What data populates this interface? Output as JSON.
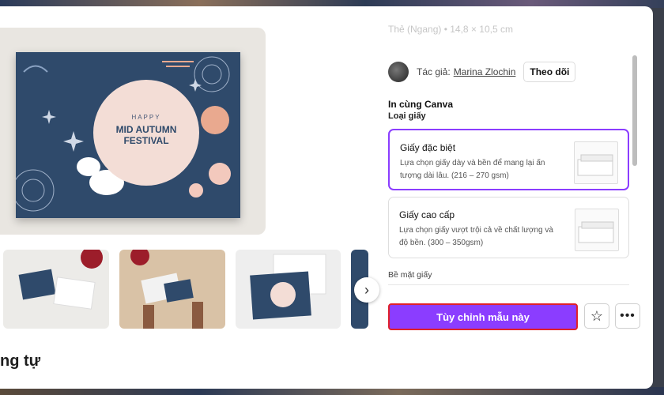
{
  "preview": {
    "card_line1": "HAPPY",
    "card_line2": "MID AUTUMN",
    "card_line3": "FESTIVAL"
  },
  "right": {
    "faded_text": "Thẻ (Ngang) • 14,8 × 10,5 cm",
    "author_label": "Tác giả:",
    "author_name": "Marina Zlochin",
    "follow_label": "Theo dõi",
    "print_title": "In cùng Canva",
    "paper_type_label": "Loại giấy",
    "options": [
      {
        "title": "Giấy đặc biệt",
        "desc": "Lựa chọn giấy dày và bền để mang lại ấn tượng dài lâu. (216 – 270 gsm)"
      },
      {
        "title": "Giấy cao cấp",
        "desc": "Lựa chọn giấy vượt trội cả về chất lượng và độ bền. (300 – 350gsm)"
      }
    ],
    "surface_label": "Bề mặt giấy",
    "customize_label": "Tùy chỉnh mẫu này"
  },
  "similar_title": "ng tự",
  "icons": {
    "next": "chevron-right-icon",
    "star": "star-icon",
    "more": "more-horizontal-icon"
  },
  "colors": {
    "accent": "#8b3dff",
    "highlight_border": "#e0202a",
    "card_bg": "#2f4a6b"
  }
}
